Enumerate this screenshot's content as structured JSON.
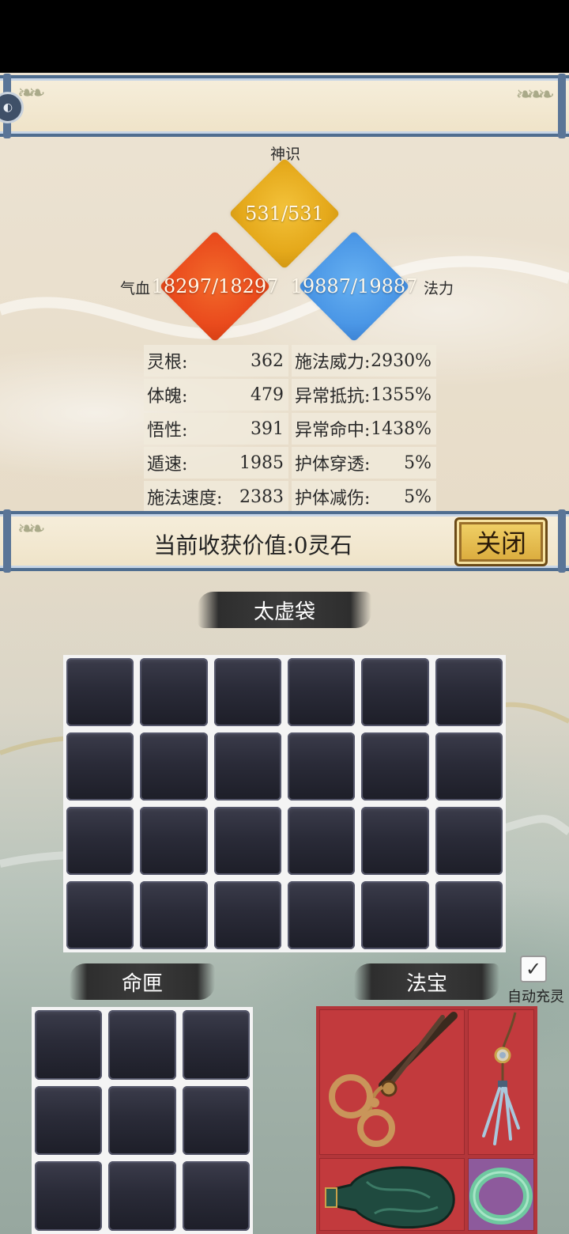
{
  "vitals": {
    "shenshi": {
      "label": "神识",
      "value": "531/531"
    },
    "qixue": {
      "label": "气血",
      "value": "18297/18297"
    },
    "fali": {
      "label": "法力",
      "value": "19887/19887"
    }
  },
  "stats": [
    [
      {
        "label": "灵根:",
        "value": "362"
      },
      {
        "label": "施法威力:",
        "value": "2930%"
      }
    ],
    [
      {
        "label": "体魄:",
        "value": "479"
      },
      {
        "label": "异常抵抗:",
        "value": "1355%"
      }
    ],
    [
      {
        "label": "悟性:",
        "value": "391"
      },
      {
        "label": "异常命中:",
        "value": "1438%"
      }
    ],
    [
      {
        "label": "遁速:",
        "value": "1985"
      },
      {
        "label": "护体穿透:",
        "value": "5%"
      }
    ],
    [
      {
        "label": "施法速度:",
        "value": "2383"
      },
      {
        "label": "护体减伤:",
        "value": "5%"
      }
    ]
  ],
  "harvest": {
    "text": "当前收获价值:0灵石"
  },
  "close_button": "关闭",
  "sections": {
    "bag_title": "太虚袋",
    "mingxia_title": "命匣",
    "fabao_title": "法宝"
  },
  "auto_charge": {
    "label": "自动充灵",
    "checked": true,
    "mark": "✓"
  },
  "fabao_items": [
    "scissors-icon",
    "tassel-pendant-icon",
    "green-vase-icon",
    "jade-bracelet-icon"
  ],
  "colors": {
    "shenshi": "#e5a91b",
    "qixue": "#ea4b1d",
    "fali": "#4b97e6",
    "fabao_bg": "#c23a3d",
    "rare_slot": "#8d5a9c",
    "banner_border": "#4f6d8f"
  }
}
